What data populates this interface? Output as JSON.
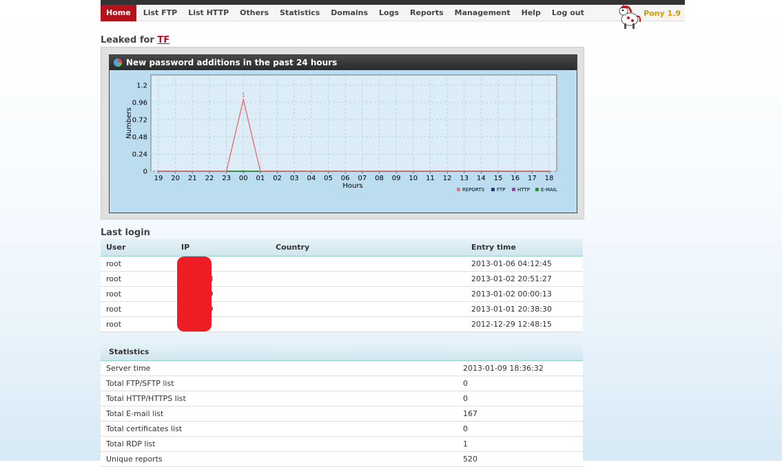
{
  "nav": {
    "items": [
      "Home",
      "List FTP",
      "List HTTP",
      "Others",
      "Statistics",
      "Domains",
      "Logs",
      "Reports",
      "Management",
      "Help",
      "Log out"
    ],
    "active": "Home",
    "brand": "Pony 1.9"
  },
  "leaked": {
    "label": "Leaked for",
    "link": "TF"
  },
  "chart": {
    "header": "New password additions in the past 24 hours",
    "chart_data": {
      "type": "line",
      "title": "New password additions in the past 24 hours",
      "xlabel": "Hours",
      "ylabel": "Numbers",
      "categories": [
        "19",
        "20",
        "21",
        "22",
        "23",
        "00",
        "01",
        "02",
        "03",
        "04",
        "05",
        "06",
        "07",
        "08",
        "09",
        "10",
        "11",
        "12",
        "13",
        "14",
        "15",
        "16",
        "17",
        "18"
      ],
      "yticks": [
        "0",
        "0.24",
        "0.48",
        "0.72",
        "0.96",
        "1.2"
      ],
      "ylim": [
        0,
        1.2
      ],
      "grid": true,
      "legend": "bottom-right",
      "data_label": "1",
      "series": [
        {
          "name": "REPORTS",
          "color": "#e8716f",
          "values": [
            0,
            0,
            0,
            0,
            0,
            1,
            0,
            0,
            0,
            0,
            0,
            0,
            0,
            0,
            0,
            0,
            0,
            0,
            0,
            0,
            0,
            0,
            0,
            0
          ]
        },
        {
          "name": "FTP",
          "color": "#1a3c8a",
          "values": [
            0,
            0,
            0,
            0,
            0,
            0,
            0,
            0,
            0,
            0,
            0,
            0,
            0,
            0,
            0,
            0,
            0,
            0,
            0,
            0,
            0,
            0,
            0,
            0
          ]
        },
        {
          "name": "HTTP",
          "color": "#b52fb8",
          "values": [
            0,
            0,
            0,
            0,
            0,
            0,
            0,
            0,
            0,
            0,
            0,
            0,
            0,
            0,
            0,
            0,
            0,
            0,
            0,
            0,
            0,
            0,
            0,
            0
          ]
        },
        {
          "name": "E-MAIL",
          "color": "#1e9a2a",
          "values": [
            0,
            0,
            0,
            0,
            0,
            0,
            0,
            0,
            0,
            0,
            0,
            0,
            0,
            0,
            0,
            0,
            0,
            0,
            0,
            0,
            0,
            0,
            0,
            0
          ]
        }
      ]
    }
  },
  "last_login": {
    "title": "Last login",
    "columns": [
      "User",
      "IP",
      "Country",
      "Entry time"
    ],
    "rows": [
      {
        "user": "root",
        "ip": "3.199",
        "country": "",
        "time": "2013-01-06 04:12:45"
      },
      {
        "user": "root",
        "ip": "33.138",
        "country": "",
        "time": "2013-01-02 20:51:27"
      },
      {
        "user": "root",
        "ip": "140.29",
        "country": "",
        "time": "2013-01-02 00:00:13"
      },
      {
        "user": "root",
        "ip": "140.29",
        "country": "",
        "time": "2013-01-01 20:38:30"
      },
      {
        "user": "root",
        "ip": "3.8",
        "country": "",
        "time": "2012-12-29 12:48:15"
      }
    ]
  },
  "statistics": {
    "title": "Statistics",
    "rows": [
      {
        "label": "Server time",
        "value": "2013-01-09 18:36:32"
      },
      {
        "label": "Total FTP/SFTP list",
        "value": "0"
      },
      {
        "label": "Total HTTP/HTTPS list",
        "value": "0"
      },
      {
        "label": "Total E-mail list",
        "value": "167"
      },
      {
        "label": "Total certificates list",
        "value": "0"
      },
      {
        "label": "Total RDP list",
        "value": "1"
      },
      {
        "label": "Unique reports",
        "value": "520"
      }
    ]
  },
  "colors": {
    "accent": "#b5121b",
    "brand": "#d49a00"
  }
}
